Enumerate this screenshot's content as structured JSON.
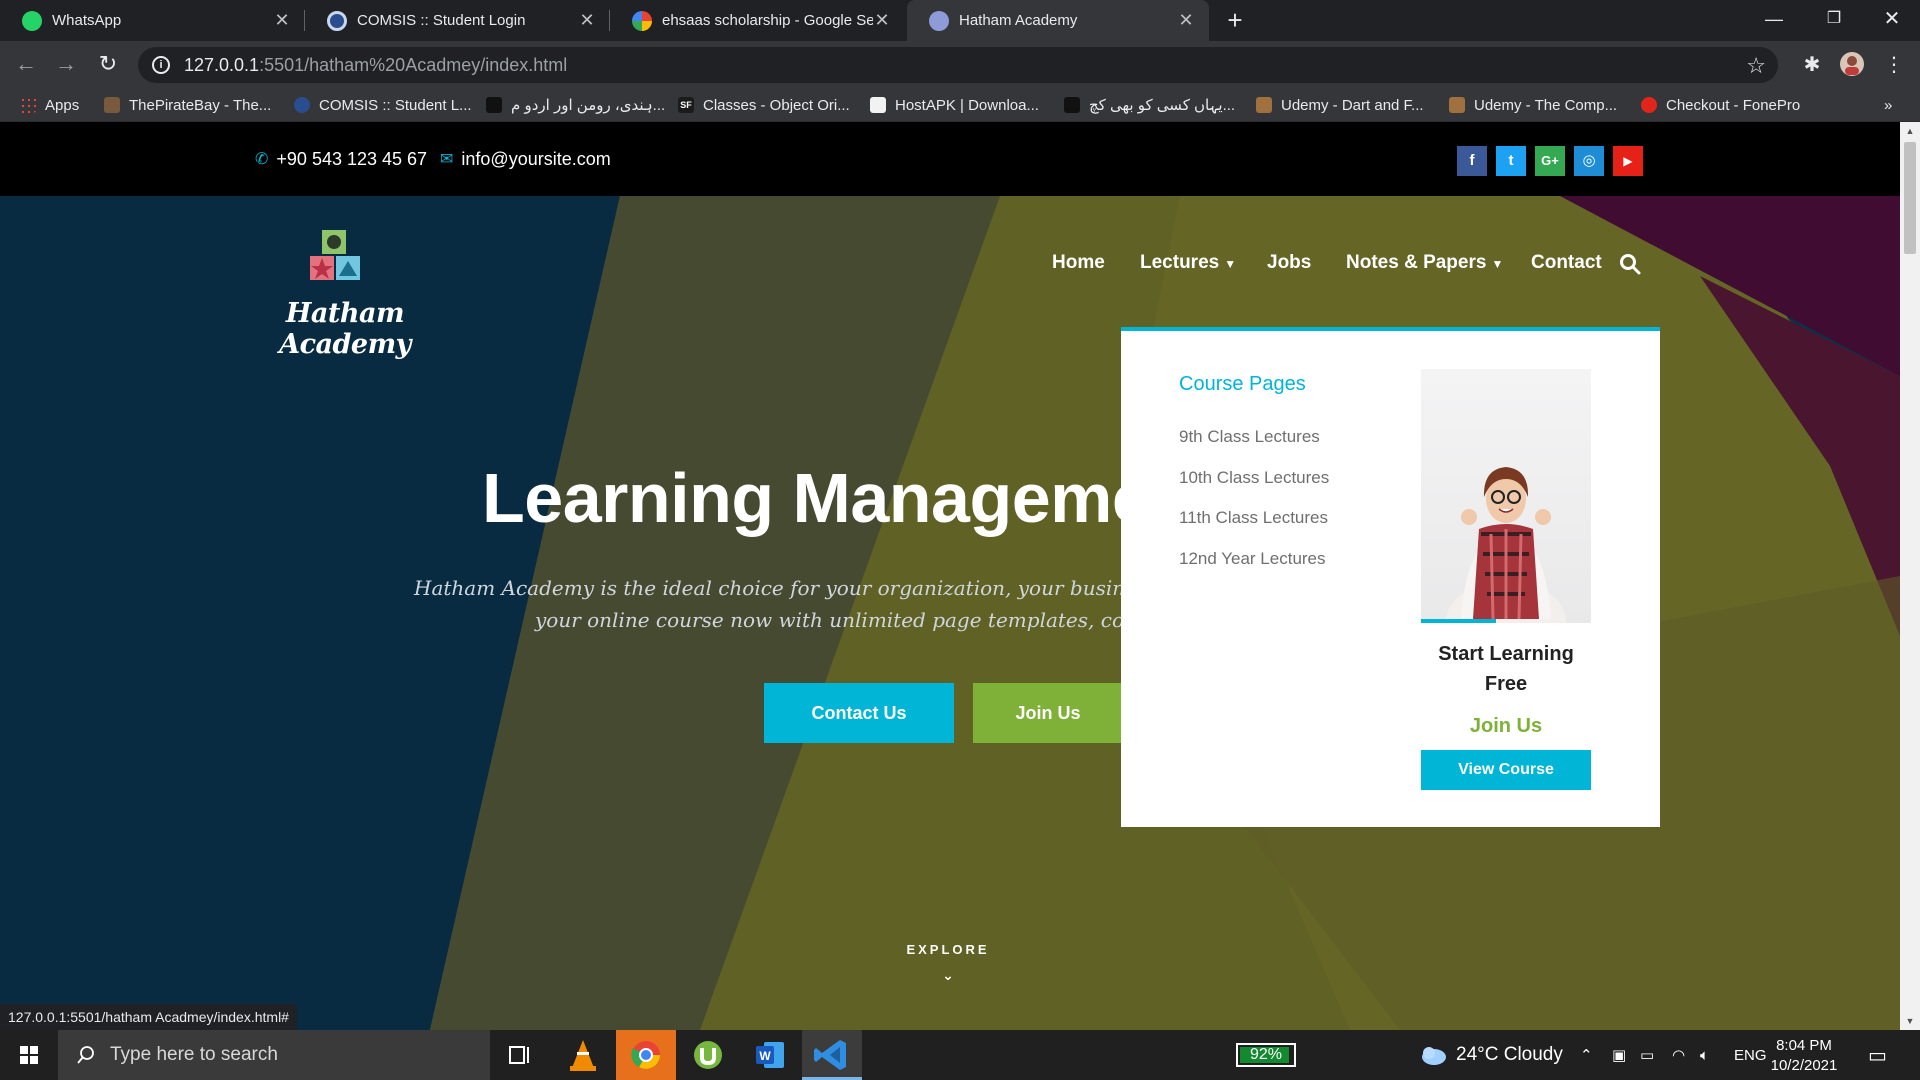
{
  "browser": {
    "tabs": [
      {
        "title": "WhatsApp",
        "active": false
      },
      {
        "title": "COMSIS :: Student Login",
        "active": false
      },
      {
        "title": "ehsaas scholarship - Google Search",
        "active": false
      },
      {
        "title": "Hatham Academy",
        "active": true
      }
    ],
    "url_host": "127.0.0.1",
    "url_path": ":5501/hatham%20Acadmey/index.html",
    "bookmarks": [
      "Apps",
      "ThePirateBay - The...",
      "COMSIS :: Student L...",
      "ہندی، رومن اور اردو م...",
      "Classes - Object Ori...",
      "HostAPK | Downloa...",
      "یہاں کسی کو بھی کچ...",
      "Udemy - Dart and F...",
      "Udemy - The Comp...",
      "Checkout - FonePro"
    ],
    "bookmarks_overflow": "»",
    "status_url": "127.0.0.1:5501/hatham Acadmey/index.html#",
    "colors": {
      "chrome_dark": "#202124",
      "chrome_mid": "#35363a"
    }
  },
  "site": {
    "topbar": {
      "phone": "+90 543 123 45 67",
      "email": "info@yoursite.com",
      "social": [
        {
          "label": "f",
          "icon": "facebook-icon",
          "color": "#3b5998"
        },
        {
          "label": "t",
          "icon": "twitter-icon",
          "color": "#1da1f2"
        },
        {
          "label": "G+",
          "icon": "google-plus-icon",
          "color": "#34a853"
        },
        {
          "label": "◎",
          "icon": "instagram-icon",
          "color": "#1f8dd6"
        },
        {
          "label": "▶",
          "icon": "youtube-icon",
          "color": "#e62117"
        }
      ]
    },
    "logo_text": "Hatham Academy",
    "nav": {
      "home": "Home",
      "lectures": "Lectures",
      "jobs": "Jobs",
      "notes": "Notes & Papers",
      "contact": "Contact"
    },
    "hero": {
      "headline": "Learning Managemen",
      "subtitle_line1": "Hatham Academy is the ideal choice for your organization, your business an",
      "subtitle_line2": "your online course now with unlimited page templates, color op",
      "btn_contact": "Contact Us",
      "btn_join": "Join Us",
      "explore": "EXPLORE"
    },
    "dropdown": {
      "title": "Course Pages",
      "items": [
        "9th Class Lectures",
        "10th Class Lectures",
        "11th Class Lectures",
        "12nd Year Lectures"
      ],
      "card_heading": "Start Learning Free",
      "card_join": "Join Us",
      "card_button": "View Course"
    },
    "colors": {
      "accent": "#00b5d6",
      "green": "#7fb139"
    }
  },
  "taskbar": {
    "search_placeholder": "Type here to search",
    "battery": "92%",
    "weather": "24°C  Cloudy",
    "language": "ENG",
    "time": "8:04 PM",
    "date": "10/2/2021"
  }
}
